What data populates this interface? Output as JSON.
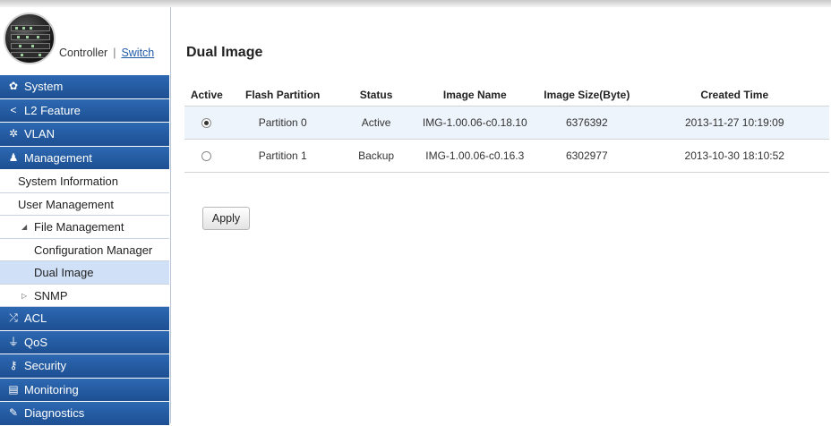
{
  "header": {
    "controller_label": "Controller",
    "separator": "|",
    "switch_label": "Switch"
  },
  "sidebar": {
    "categories_top": [
      {
        "label": "System",
        "icon": "gear-icon"
      },
      {
        "label": "L2 Feature",
        "icon": "share-icon"
      },
      {
        "label": "VLAN",
        "icon": "network-icon"
      },
      {
        "label": "Management",
        "icon": "user-icon"
      }
    ],
    "management_items": {
      "system_information": "System Information",
      "user_management": "User Management",
      "file_management": "File Management",
      "configuration_manager": "Configuration Manager",
      "dual_image": "Dual Image",
      "snmp": "SNMP"
    },
    "categories_bottom": [
      {
        "label": "ACL",
        "icon": "shuffle-icon"
      },
      {
        "label": "QoS",
        "icon": "qos-icon"
      },
      {
        "label": "Security",
        "icon": "key-icon"
      },
      {
        "label": "Monitoring",
        "icon": "monitor-icon"
      },
      {
        "label": "Diagnostics",
        "icon": "wrench-icon"
      }
    ]
  },
  "page": {
    "title": "Dual Image"
  },
  "table": {
    "headers": [
      "Active",
      "Flash Partition",
      "Status",
      "Image Name",
      "Image Size(Byte)",
      "Created Time"
    ],
    "rows": [
      {
        "active": true,
        "partition": "Partition 0",
        "status": "Active",
        "image_name": "IMG-1.00.06-c0.18.10",
        "size": "6376392",
        "created": "2013-11-27 10:19:09"
      },
      {
        "active": false,
        "partition": "Partition 1",
        "status": "Backup",
        "image_name": "IMG-1.00.06-c0.16.3",
        "size": "6302977",
        "created": "2013-10-30 18:10:52"
      }
    ]
  },
  "actions": {
    "apply_label": "Apply"
  }
}
